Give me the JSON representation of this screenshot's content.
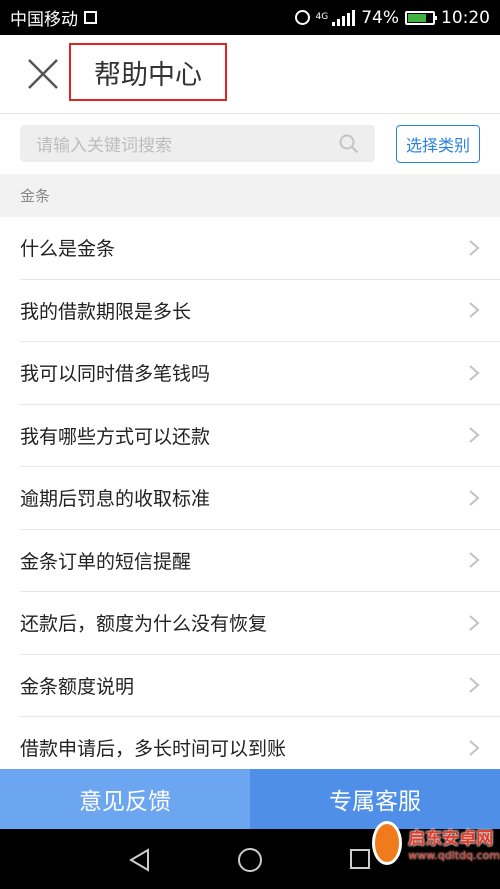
{
  "status_bar": {
    "carrier": "中国移动",
    "network_type": "4G",
    "battery_percent": "74%",
    "battery_level": 0.74,
    "time": "10:20"
  },
  "header": {
    "title": "帮助中心",
    "close_icon": "close-icon"
  },
  "search": {
    "placeholder": "请输入关键词搜索",
    "select_category_label": "选择类别"
  },
  "section": {
    "title": "金条"
  },
  "list_items": [
    "什么是金条",
    "我的借款期限是多长",
    "我可以同时借多笔钱吗",
    "我有哪些方式可以还款",
    "逾期后罚息的收取标准",
    "金条订单的短信提醒",
    "还款后，额度为什么没有恢复",
    "金条额度说明",
    "借款申请后，多长时间可以到账"
  ],
  "bottom_bar": {
    "feedback_label": "意见反馈",
    "service_label": "专属客服"
  },
  "watermark": {
    "name": "启东安卓网",
    "url": "www.qdltdq.com"
  },
  "colors": {
    "accent_blue": "#2a82e4",
    "highlight_red": "#e02424",
    "feedback_bg": "#6da6f0",
    "service_bg": "#4f8fe8"
  }
}
